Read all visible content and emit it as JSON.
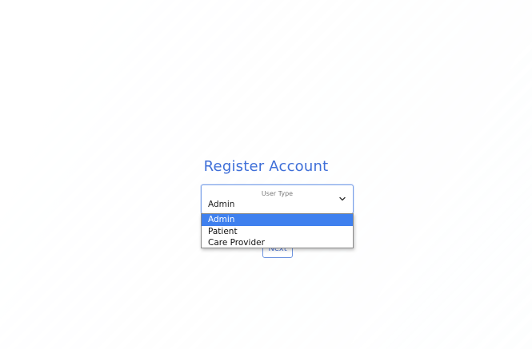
{
  "title": "Register Account",
  "user_type_select": {
    "label": "User Type",
    "value": "Admin",
    "options": [
      "Admin",
      "Patient",
      "Care Provider"
    ],
    "selected_index": 0
  },
  "next_button": {
    "label": "Next"
  },
  "colors": {
    "accent": "#3f6fd8",
    "selected_option": "#3f80ee",
    "border": "#7aa0e8"
  }
}
